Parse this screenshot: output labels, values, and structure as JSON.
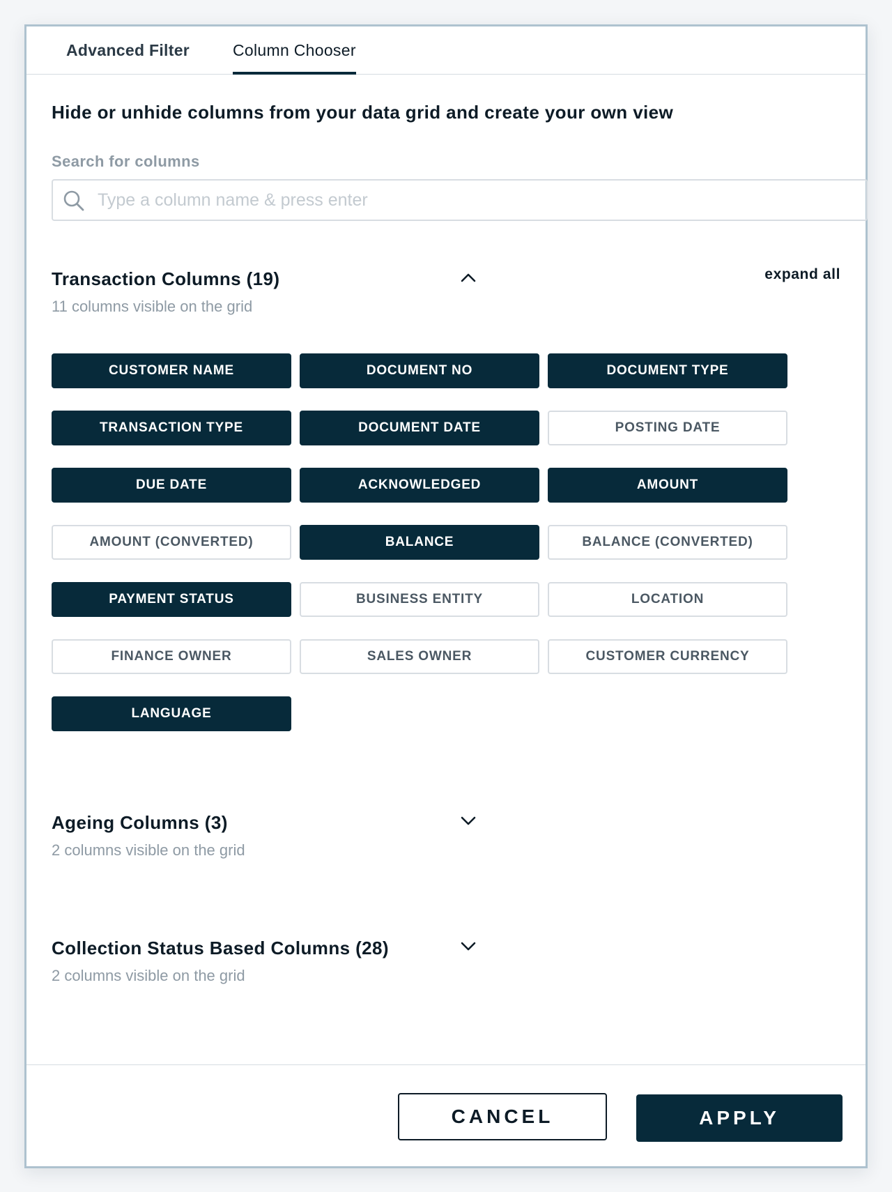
{
  "tabs": [
    {
      "label": "Advanced Filter"
    },
    {
      "label": "Column Chooser"
    }
  ],
  "headline": "Hide or unhide columns from your data grid and create your own view",
  "search": {
    "label": "Search for columns",
    "placeholder": "Type a column name & press enter",
    "value": ""
  },
  "sections": [
    {
      "title": "Transaction Columns (19)",
      "subtitle": "11 columns visible on the grid",
      "expanded": true,
      "icon": "chevron-up-icon"
    },
    {
      "title": "Ageing Columns (3)",
      "subtitle": "2 columns visible on the grid",
      "expanded": false,
      "icon": "chevron-down-icon"
    },
    {
      "title": "Collection Status Based Columns (28)",
      "subtitle": "2 columns visible on the grid",
      "expanded": false,
      "icon": "chevron-down-icon"
    }
  ],
  "expand_all_label": "expand all",
  "columns": [
    {
      "label": "CUSTOMER NAME",
      "selected": true
    },
    {
      "label": "DOCUMENT NO",
      "selected": true
    },
    {
      "label": "DOCUMENT TYPE",
      "selected": true
    },
    {
      "label": "TRANSACTION TYPE",
      "selected": true
    },
    {
      "label": "DOCUMENT DATE",
      "selected": true
    },
    {
      "label": "POSTING DATE",
      "selected": false
    },
    {
      "label": "DUE DATE",
      "selected": true
    },
    {
      "label": "ACKNOWLEDGED",
      "selected": true
    },
    {
      "label": "AMOUNT",
      "selected": true
    },
    {
      "label": "AMOUNT (CONVERTED)",
      "selected": false
    },
    {
      "label": "BALANCE",
      "selected": true
    },
    {
      "label": "BALANCE (CONVERTED)",
      "selected": false
    },
    {
      "label": "PAYMENT STATUS",
      "selected": true
    },
    {
      "label": "BUSINESS ENTITY",
      "selected": false
    },
    {
      "label": "LOCATION",
      "selected": false
    },
    {
      "label": "FINANCE OWNER",
      "selected": false
    },
    {
      "label": "SALES OWNER",
      "selected": false
    },
    {
      "label": "CUSTOMER CURRENCY",
      "selected": false
    },
    {
      "label": "LANGUAGE",
      "selected": true
    }
  ],
  "footer": {
    "cancel_label": "CANCEL",
    "apply_label": "APPLY"
  },
  "colors": {
    "accent": "#072a3a",
    "muted_text": "#8e9aa4",
    "chip_border": "#d8dde2"
  }
}
